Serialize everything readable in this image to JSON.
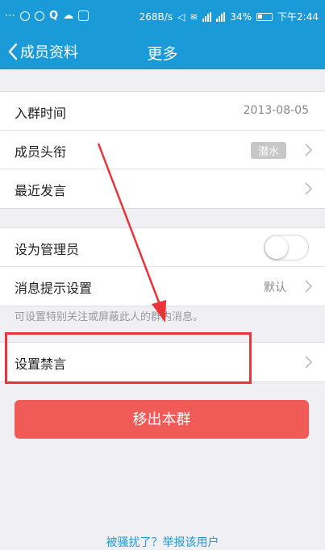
{
  "status_bar": {
    "left_icons": [
      "dots-icon",
      "chat-bubble-icon",
      "chat-bubble-icon",
      "browser-icon",
      "cloud-icon",
      "qq-icon"
    ],
    "net_speed": "268B/s",
    "battery": "34%",
    "time": "下午2:44"
  },
  "header": {
    "back_label": "成员资料",
    "title": "更多"
  },
  "group1": [
    {
      "label": "入群时间",
      "value": "2013-08-05"
    },
    {
      "label": "成员头衔",
      "badge": "潜水"
    },
    {
      "label": "最近发言"
    }
  ],
  "group2": [
    {
      "label": "设为管理员",
      "toggle": false
    },
    {
      "label": "消息提示设置",
      "value": "默认"
    }
  ],
  "hint": "可设置特别关注或屏蔽此人的群内消息。",
  "group3": [
    {
      "label": "设置禁言"
    }
  ],
  "remove_button": "移出本群",
  "report_link": "被骚扰了？举报该用户",
  "colors": {
    "brand": "#1a9bd8",
    "danger_button": "#f05a57",
    "annotation_red": "#e9343a"
  }
}
